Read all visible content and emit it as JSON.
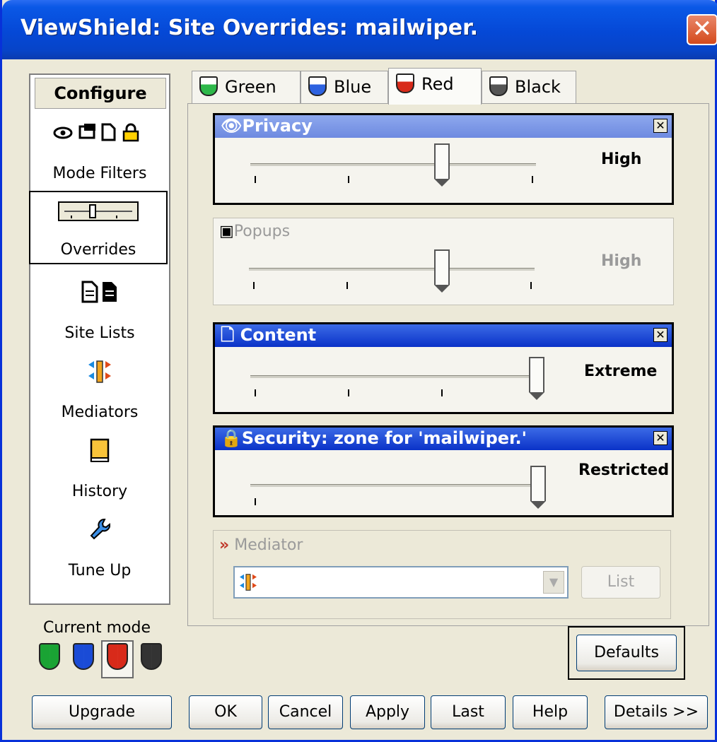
{
  "window": {
    "title": "ViewShield: Site Overrides: mailwiper.",
    "close_glyph": "✕"
  },
  "nav": {
    "header": "Configure",
    "items": [
      {
        "id": "mode-filters",
        "label": "Mode Filters",
        "icon": "👁▣🗋🔒"
      },
      {
        "id": "overrides",
        "label": "Overrides",
        "icon": "slider-icon"
      },
      {
        "id": "site-lists",
        "label": "Site Lists",
        "icon": "🗋🗎"
      },
      {
        "id": "mediators",
        "label": "Mediators",
        "icon": "mediator-arrows-icon"
      },
      {
        "id": "history",
        "label": "History",
        "icon": "book-icon"
      },
      {
        "id": "tune-up",
        "label": "Tune Up",
        "icon": "wrench-icon"
      }
    ],
    "current_mode_label": "Current mode",
    "mode_colors": [
      "#1aa334",
      "#1a4bd6",
      "#d82a1a",
      "#333333"
    ],
    "selected_mode": "Red"
  },
  "tabs": [
    {
      "label": "Green",
      "color": "#2eb84a"
    },
    {
      "label": "Blue",
      "color": "#2d62e0"
    },
    {
      "label": "Red",
      "color": "#d82a1a"
    },
    {
      "label": "Black",
      "color": "#555555"
    }
  ],
  "active_tab": "Red",
  "groups": {
    "privacy": {
      "title": "Privacy",
      "icon": "👁",
      "level": "High",
      "enabled": true
    },
    "popups": {
      "title": "Popups",
      "icon": "▣",
      "level": "High",
      "enabled": false
    },
    "content": {
      "title": "Content",
      "icon": "🗋",
      "level": "Extreme",
      "enabled": true
    },
    "security": {
      "title": "Security: zone for 'mailwiper.'",
      "icon": "🔒",
      "level": "Restricted",
      "enabled": true
    }
  },
  "mediator": {
    "label": "Mediator",
    "prefix": "»",
    "list_button": "List",
    "selected_value": ""
  },
  "buttons": {
    "defaults": "Defaults",
    "upgrade": "Upgrade",
    "ok": "OK",
    "cancel": "Cancel",
    "apply": "Apply",
    "last": "Last",
    "help": "Help",
    "details": "Details >>"
  }
}
